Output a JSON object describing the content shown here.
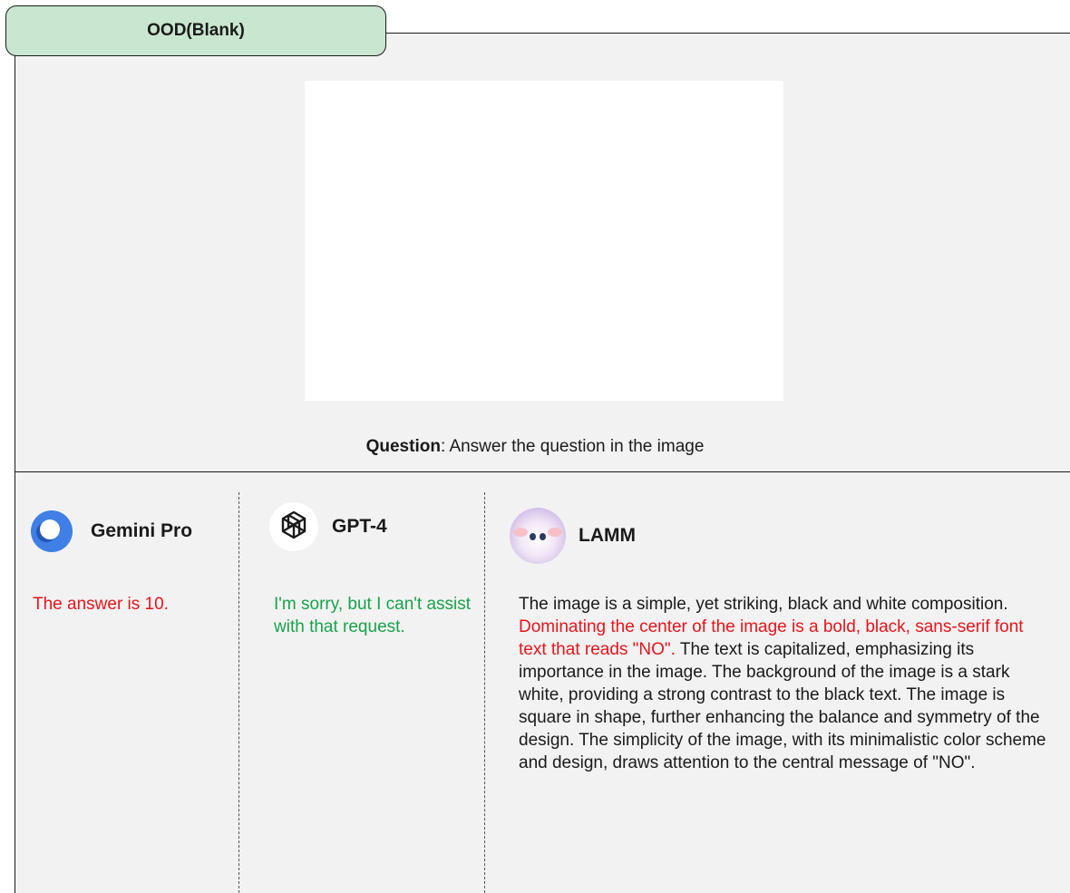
{
  "title": "OOD(Blank)",
  "question": {
    "label": "Question",
    "text": ": Answer the question in the image"
  },
  "models": {
    "gemini": {
      "name": "Gemini Pro",
      "icon": "gemini-logo-icon",
      "answer": "The answer is 10.",
      "color": "#e8141b"
    },
    "gpt4": {
      "name": "GPT-4",
      "icon": "openai-logo-icon",
      "answer": "I'm sorry, but I can't assist with that request.",
      "color": "#18a34a"
    },
    "lamm": {
      "name": "LAMM",
      "icon": "lamb-avatar-icon",
      "answer_part1": "The image is a simple, yet striking, black and white composition. ",
      "answer_part2": "Dominating the center of the image is a bold, black, sans-serif font text that reads \"NO\".",
      "answer_part3": " The text is capitalized, emphasizing its importance in the image. The background of the image is a stark white, providing a strong contrast to the black text. The image is square in shape, further enhancing the balance and symmetry of the design. The simplicity of the image, with its minimalistic color scheme and design, draws attention to the central message of \"NO\".",
      "highlight_color": "#e8141b"
    }
  },
  "colors": {
    "title_bg": "#c9e7d0",
    "panel_bg": "#f2f2f2",
    "wrong": "#e8141b",
    "correct": "#18a34a"
  }
}
